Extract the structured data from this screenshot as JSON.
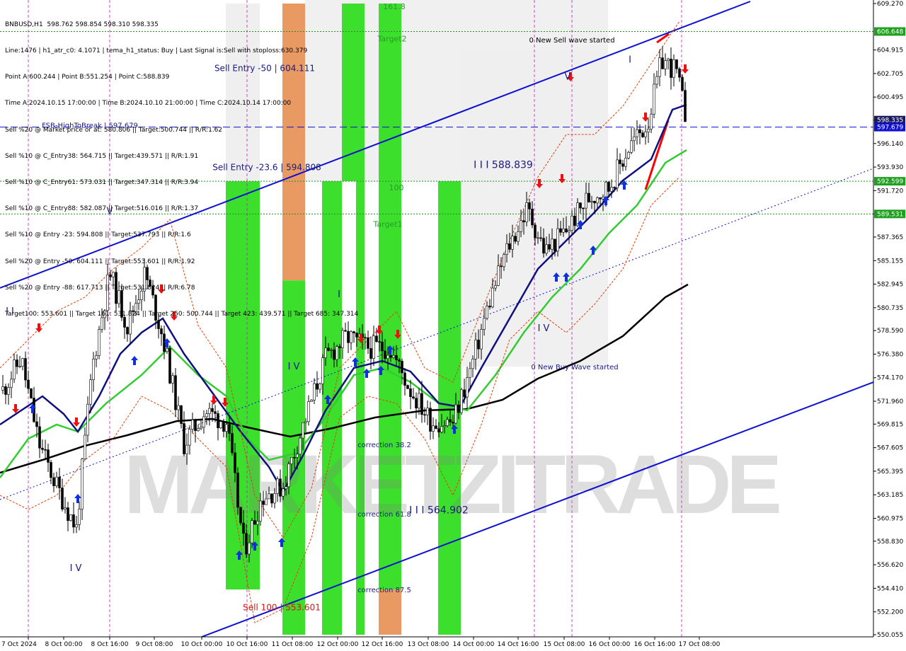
{
  "header": {
    "lines": [
      "BNBUSD,H1  598.762 598.854 598.310 598.335",
      "Line:1476 | h1_atr_c0: 4.1071 | tema_h1_status: Buy | Last Signal is:Sell with stoploss:630.379",
      "Point A:600.244 | Point B:551.254 | Point C:588.839",
      "Time A:2024.10.15 17:00:00 | Time B:2024.10.10 21:00:00 | Time C:2024.10.14 17:00:00",
      "Sell %20 @ Market price or at: 580.806 || Target:500.744 || R/R:1.62",
      "Sell %10 @ C_Entry38: 564.715 || Target:439.571 || R/R:1.91",
      "Sell %10 @ C_Entry61: 573.031 || Target:347.314 || R/R:3.94",
      "Sell %10 @ C_Entry88: 582.087 || Target:516.016 || R/R:1.37",
      "Sell %10 @ Entry -23: 594.808 || Target:537.793 || R/R:1.6",
      "Sell %20 @ Entry -50: 604.111 || Target:553.601 || R/R:1.92",
      "Sell %20 @ Entry -88: 617.713 || Target:531.824 || R/R:6.78",
      "Target100: 553.601 || Target 161: 531.824 || Target 250: 500.744 || Target 423: 439.571 || Target 685: 347.314"
    ]
  },
  "watermark": "MARKETZITRADE",
  "colors": {
    "green_zone": "#33dd22",
    "orange_zone": "#e8955a",
    "upper_panel": "#eeeeee",
    "blue_line": "#1010d0",
    "price_tag_green": "#20a020",
    "price_tag_navy": "#1a1a60"
  },
  "chart_data": {
    "type": "candlestick",
    "symbol": "BNBUSD",
    "timeframe": "H1",
    "ylim": [
      550.055,
      609.27
    ],
    "y_ticks": [
      609.27,
      604.915,
      602.705,
      600.495,
      598.335,
      596.14,
      593.93,
      591.72,
      589.531,
      587.365,
      585.155,
      582.945,
      580.735,
      578.59,
      576.38,
      574.17,
      571.96,
      569.815,
      567.605,
      565.395,
      563.185,
      560.975,
      558.83,
      556.62,
      554.41,
      552.2,
      550.055
    ],
    "x_ticks": [
      "7 Oct 2024",
      "8 Oct 00:00",
      "8 Oct 16:00",
      "9 Oct 08:00",
      "10 Oct 00:00",
      "10 Oct 16:00",
      "11 Oct 08:00",
      "12 Oct 00:00",
      "12 Oct 16:00",
      "13 Oct 08:00",
      "14 Oct 00:00",
      "14 Oct 16:00",
      "15 Oct 08:00",
      "16 Oct 00:00",
      "16 Oct 16:00",
      "17 Oct 08:00"
    ],
    "price_tags": [
      {
        "label": "606.648",
        "value": 606.648,
        "color": "green"
      },
      {
        "label": "598.335",
        "value": 598.335,
        "color": "navy"
      },
      {
        "label": "597.679",
        "value": 597.679,
        "color": "blue"
      },
      {
        "label": "592.599",
        "value": 592.599,
        "color": "green"
      },
      {
        "label": "589.531",
        "value": 589.531,
        "color": "green"
      }
    ],
    "horizontal_levels": [
      {
        "value": 606.648,
        "style": "dotted",
        "color": "green"
      },
      {
        "value": 597.679,
        "style": "dashed",
        "color": "blue"
      },
      {
        "value": 592.599,
        "style": "dotted",
        "color": "green"
      },
      {
        "value": 589.531,
        "style": "dotted",
        "color": "green"
      }
    ],
    "annotations": [
      {
        "text": "161.8",
        "x_label": "12 Oct 16:00",
        "value": 609.0,
        "color": "green"
      },
      {
        "text": "Target2",
        "x_label": "12 Oct 16:00",
        "value": 606.0,
        "color": "green"
      },
      {
        "text": "0 New Sell wave started",
        "x_label": "15 Oct 08:00",
        "value": 605.9,
        "color": "black"
      },
      {
        "text": "Sell Entry -50 | 604.111",
        "x_label": "10 Oct 16:00",
        "value": 603.2,
        "color": "navy"
      },
      {
        "text": "FSB-HighToBreak | 597.679",
        "x_label": "8 Oct 00:00",
        "value": 597.9,
        "color": "navy"
      },
      {
        "text": "Sell Entry -23.6 | 594.808",
        "x_label": "10 Oct 16:00",
        "value": 593.9,
        "color": "navy"
      },
      {
        "text": "I I I 588.839",
        "x_label": "14 Oct 16:00",
        "value": 594.1,
        "color": "navy"
      },
      {
        "text": "100",
        "x_label": "12 Oct 16:00",
        "value": 592.0,
        "color": "green"
      },
      {
        "text": "Target1",
        "x_label": "12 Oct 16:00",
        "value": 588.6,
        "color": "green"
      },
      {
        "text": "I",
        "x_label": "16 Oct 16:00",
        "value": 604.0,
        "color": "navy"
      },
      {
        "text": "V",
        "x_label": "15 Oct 08:00",
        "value": 602.4,
        "color": "navy"
      },
      {
        "text": "V",
        "x_label": "8 Oct 16:00",
        "value": 589.8,
        "color": "navy"
      },
      {
        "text": "I I",
        "x_label": "7 Oct 2024",
        "value": 580.4,
        "color": "navy"
      },
      {
        "text": "I",
        "x_label": "12 Oct 00:00",
        "value": 582.0,
        "color": "navy"
      },
      {
        "text": "I V",
        "x_label": "11 Oct 08:00",
        "value": 575.2,
        "color": "navy"
      },
      {
        "text": "I V",
        "x_label": "15 Oct 08:00",
        "value": 578.8,
        "color": "navy"
      },
      {
        "text": "0 New Buy Wave started",
        "x_label": "15 Oct 08:00",
        "value": 575.2,
        "color": "navy"
      },
      {
        "text": "correction 38.2",
        "x_label": "12 Oct 16:00",
        "value": 567.9,
        "color": "navy"
      },
      {
        "text": "correction 61.8",
        "x_label": "12 Oct 16:00",
        "value": 561.4,
        "color": "navy"
      },
      {
        "text": "I I I 564.902",
        "x_label": "13 Oct 08:00",
        "value": 561.7,
        "color": "navy"
      },
      {
        "text": "correction 87.5",
        "x_label": "12 Oct 16:00",
        "value": 554.3,
        "color": "navy"
      },
      {
        "text": "Sell 100 | 553.601",
        "x_label": "10 Oct 16:00",
        "value": 552.6,
        "color": "red"
      },
      {
        "text": "I V",
        "x_label": "8 Oct 00:00",
        "value": 556.3,
        "color": "navy"
      }
    ],
    "zones": [
      {
        "x_from": "10 Oct 16:00",
        "y_range": [
          554.3,
          592.6
        ],
        "color": "green"
      },
      {
        "x_from": "10 Oct 16:00",
        "y_range": [
          592.6,
          609.27
        ],
        "color": "panel"
      },
      {
        "x_from": "11 Oct 08:00",
        "y_range": [
          550.055,
          583.3
        ],
        "color": "green"
      },
      {
        "x_from": "11 Oct 08:00",
        "y_range": [
          583.3,
          609.27
        ],
        "color": "orange"
      },
      {
        "x_from": "11 Oct 08:00",
        "y_range": [
          583.3,
          609.27
        ],
        "color": "panel"
      },
      {
        "x_from": "12 Oct 00:00",
        "y_range": [
          550.055,
          592.6
        ],
        "color": "green"
      },
      {
        "x_from": "12 Oct 00:00",
        "y_range": [
          592.6,
          609.27
        ],
        "color": "green"
      },
      {
        "x_from": "12 Oct 00:00",
        "y_range": [
          550.055,
          592.6
        ],
        "color": "green"
      },
      {
        "x_from": "12 Oct 16:00",
        "y_range": [
          550.055,
          609.27
        ],
        "color": "green"
      },
      {
        "x_from": "12 Oct 16:00",
        "y_range": [
          550.055,
          554.3
        ],
        "color": "orange"
      },
      {
        "x_from": "13 Oct 08:00",
        "y_range": [
          550.055,
          592.6
        ],
        "color": "green"
      },
      {
        "x_from": "14 Oct 00:00",
        "y_range": [
          550.055,
          604.9
        ],
        "color": "panel"
      }
    ]
  }
}
